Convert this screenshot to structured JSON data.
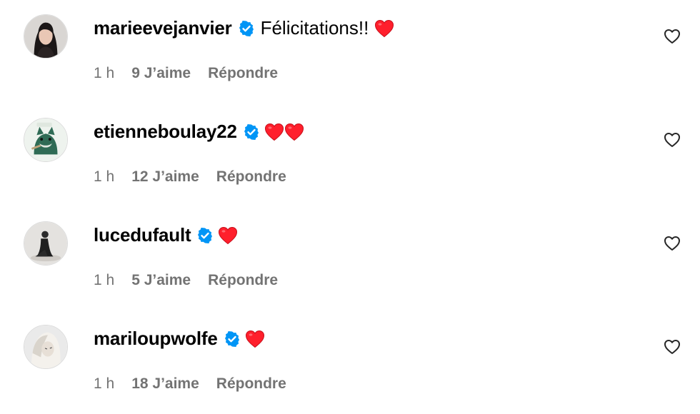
{
  "comments": [
    {
      "username": "marieevejanvier",
      "text": "Félicitations!!",
      "heart_count": 1,
      "time": "1 h",
      "likes": "9 J’aime",
      "reply": "Répondre",
      "avatar": "woman-portrait-avatar"
    },
    {
      "username": "etienneboulay22",
      "text": "",
      "heart_count": 2,
      "time": "1 h",
      "likes": "12 J’aime",
      "reply": "Répondre",
      "avatar": "cartoon-dog-avatar"
    },
    {
      "username": "lucedufault",
      "text": "",
      "heart_count": 1,
      "time": "1 h",
      "likes": "5 J’aime",
      "reply": "Répondre",
      "avatar": "seated-figure-avatar"
    },
    {
      "username": "mariloupwolfe",
      "text": "",
      "heart_count": 1,
      "time": "1 h",
      "likes": "18 J’aime",
      "reply": "Répondre",
      "avatar": "blonde-woman-avatar"
    }
  ],
  "icons": {
    "verified": "verified-badge-icon",
    "heart_emoji": "red-heart-emoji-icon",
    "like": "heart-outline-icon"
  },
  "colors": {
    "verified_blue": "#0095f6",
    "heart_red": "#ff1f2c",
    "meta_gray": "#737373"
  }
}
